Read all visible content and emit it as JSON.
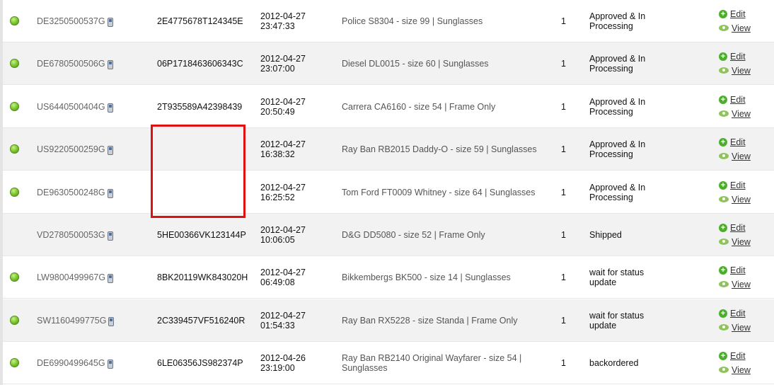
{
  "columns": [
    "status",
    "order_id",
    "tracking",
    "date",
    "product",
    "qty",
    "state",
    "actions"
  ],
  "action_labels": {
    "edit": "Edit",
    "view": "View"
  },
  "rows": [
    {
      "status_dot": true,
      "order_id": "DE3250500537G",
      "tracking": "2E4775678T124345E",
      "date": "2012-04-27",
      "time": "23:47:33",
      "product": "Police S8304 - size 99 | Sunglasses",
      "qty": "1",
      "state": "Approved & In Processing"
    },
    {
      "status_dot": true,
      "order_id": "DE6780500506G",
      "tracking": "06P1718463606343C",
      "date": "2012-04-27",
      "time": "23:07:00",
      "product": "Diesel DL0015 - size 60 | Sunglasses",
      "qty": "1",
      "state": "Approved & In Processing"
    },
    {
      "status_dot": true,
      "order_id": "US6440500404G",
      "tracking": "2T935589A42398439",
      "date": "2012-04-27",
      "time": "20:50:49",
      "product": "Carrera CA6160 - size 54 | Frame Only",
      "qty": "1",
      "state": "Approved & In Processing"
    },
    {
      "status_dot": true,
      "order_id": "US9220500259G",
      "tracking": "",
      "date": "2012-04-27",
      "time": "16:38:32",
      "product": "Ray Ban RB2015 Daddy-O - size 59 | Sunglasses",
      "qty": "1",
      "state": "Approved & In Processing"
    },
    {
      "status_dot": true,
      "order_id": "DE9630500248G",
      "tracking": "",
      "date": "2012-04-27",
      "time": "16:25:52",
      "product": "Tom Ford FT0009 Whitney - size 64 | Sunglasses",
      "qty": "1",
      "state": "Approved & In Processing"
    },
    {
      "status_dot": false,
      "order_id": "VD2780500053G",
      "tracking": "5HE00366VK123144P",
      "date": "2012-04-27",
      "time": "10:06:05",
      "product": "D&G DD5080 - size 52 | Frame Only",
      "qty": "1",
      "state": "Shipped"
    },
    {
      "status_dot": true,
      "order_id": "LW9800499967G",
      "tracking": "8BK20119WK843020H",
      "date": "2012-04-27",
      "time": "06:49:08",
      "product": "Bikkembergs BK500 - size 14 | Sunglasses",
      "qty": "1",
      "state": "wait for status update"
    },
    {
      "status_dot": true,
      "order_id": "SW1160499775G",
      "tracking": "2C339457VF516240R",
      "date": "2012-04-27",
      "time": "01:54:33",
      "product": "Ray Ban RX5228 - size Standa | Frame Only",
      "qty": "1",
      "state": "wait for status update"
    },
    {
      "status_dot": true,
      "order_id": "DE6990499645G",
      "tracking": "6LE06356JS982374P",
      "date": "2012-04-26",
      "time": "23:19:00",
      "product": "Ray Ban RB2140 Original Wayfarer - size 54 | Sunglasses",
      "qty": "1",
      "state": "backordered"
    }
  ]
}
